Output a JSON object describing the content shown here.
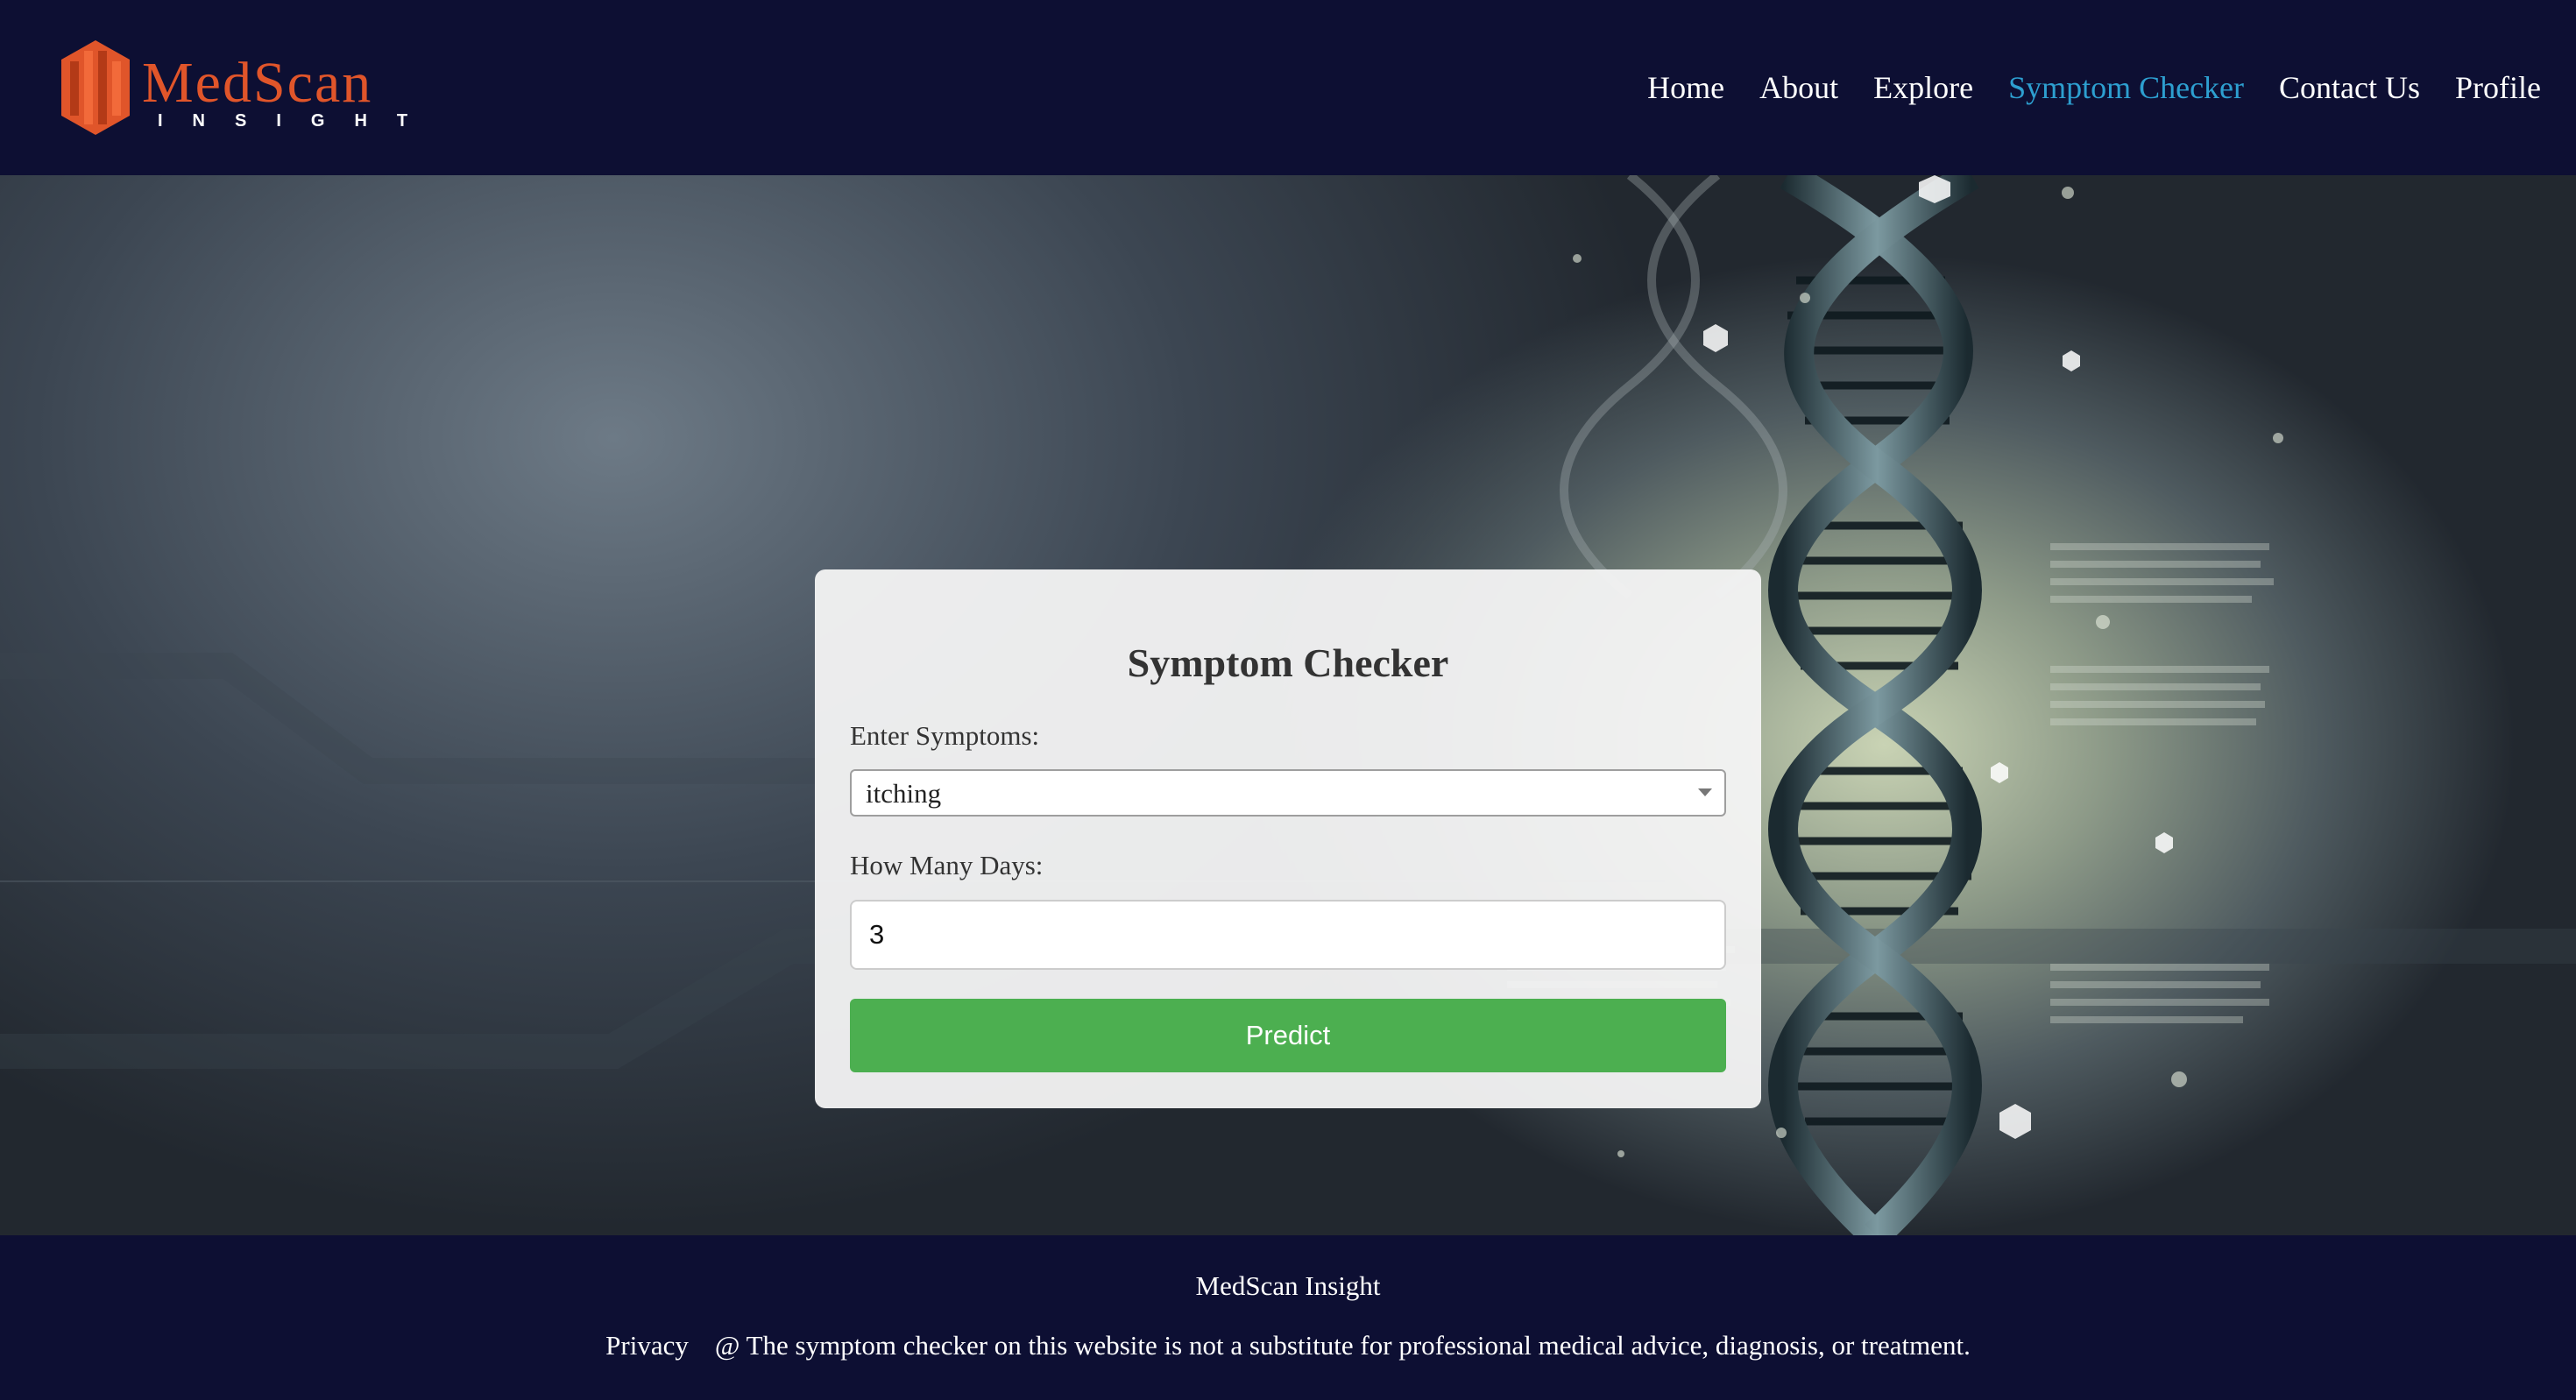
{
  "brand": {
    "name": "MedScan",
    "tagline": "INSIGHT",
    "accent_color": "#e0552a"
  },
  "nav": {
    "items": [
      {
        "label": "Home"
      },
      {
        "label": "About"
      },
      {
        "label": "Explore"
      },
      {
        "label": "Symptom Checker",
        "active": true
      },
      {
        "label": "Contact Us"
      },
      {
        "label": "Profile"
      }
    ],
    "active_color": "#2d9fd0"
  },
  "form": {
    "title": "Symptom Checker",
    "symptoms_label": "Enter Symptoms:",
    "symptoms_value": "itching",
    "days_label": "How Many Days:",
    "days_value": "3",
    "submit_label": "Predict",
    "submit_color": "#4caf50"
  },
  "footer": {
    "brand": "MedScan Insight",
    "privacy_label": "Privacy",
    "disclaimer": "@ The symptom checker on this website is not a substitute for professional medical advice, diagnosis, or treatment."
  }
}
